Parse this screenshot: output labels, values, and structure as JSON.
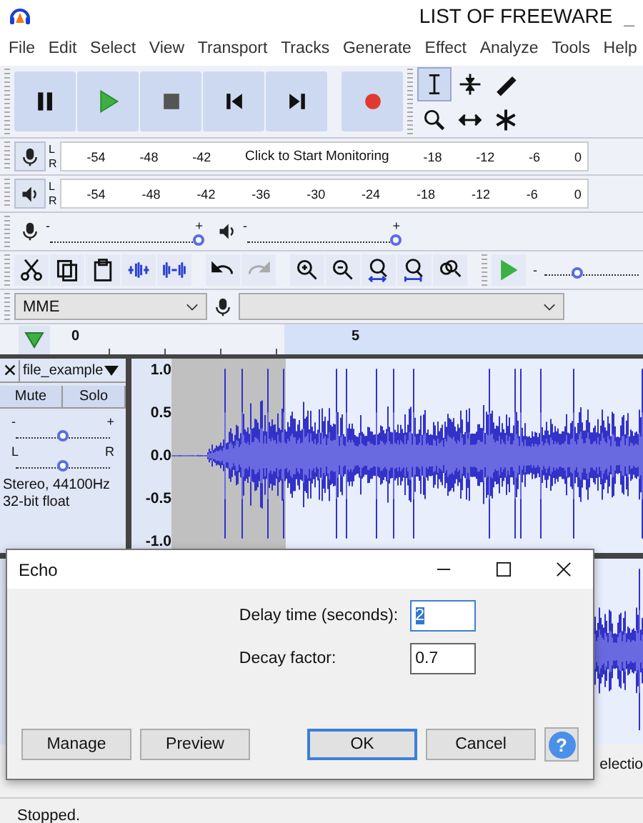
{
  "window": {
    "title": "LIST OF FREEWARE",
    "minimize_label": "_"
  },
  "menu": [
    "File",
    "Edit",
    "Select",
    "View",
    "Transport",
    "Tracks",
    "Generate",
    "Effect",
    "Analyze",
    "Tools",
    "Help"
  ],
  "transport": [
    {
      "kind": "pause"
    },
    {
      "kind": "play"
    },
    {
      "kind": "stop"
    },
    {
      "kind": "skip-start"
    },
    {
      "kind": "skip-end"
    },
    {
      "kind": "record"
    }
  ],
  "tools": [
    {
      "kind": "select",
      "selected": true
    },
    {
      "kind": "envelope",
      "selected": false
    },
    {
      "kind": "draw",
      "selected": false
    },
    {
      "kind": "zoom",
      "selected": false
    },
    {
      "kind": "time-shift",
      "selected": false
    },
    {
      "kind": "multi",
      "selected": false
    }
  ],
  "record_meter": {
    "left": "L",
    "right": "R",
    "scale": [
      "-54",
      "-48",
      "-42",
      "Click to Start Monitoring",
      "-18",
      "-12",
      "-6",
      "0"
    ]
  },
  "playback_meter": {
    "left": "L",
    "right": "R",
    "scale": [
      "-54",
      "-48",
      "-42",
      "-36",
      "-30",
      "-24",
      "-18",
      "-12",
      "-6",
      "0"
    ]
  },
  "mixer": {
    "recording": {
      "min": "-",
      "max": "+",
      "level": 1
    },
    "playback": {
      "min": "-",
      "max": "+",
      "level": 1
    }
  },
  "edit_toolbar": [
    {
      "kind": "cut",
      "disabled": false
    },
    {
      "kind": "copy",
      "disabled": false
    },
    {
      "kind": "paste",
      "disabled": false
    },
    {
      "kind": "trim",
      "disabled": false
    },
    {
      "kind": "silence",
      "disabled": false
    },
    {
      "kind": "undo",
      "disabled": false
    },
    {
      "kind": "redo",
      "disabled": true
    },
    {
      "kind": "zoom-in",
      "disabled": false
    },
    {
      "kind": "zoom-out",
      "disabled": false
    },
    {
      "kind": "fit-selection",
      "disabled": false
    },
    {
      "kind": "fit-project",
      "disabled": false
    },
    {
      "kind": "zoom-toggle",
      "disabled": false
    }
  ],
  "play_at_speed": {
    "min": "-",
    "level": 0.35
  },
  "device_toolbar": {
    "host": "MME"
  },
  "timeline": {
    "labels": [
      "0",
      "5"
    ]
  },
  "track": {
    "name": "file_example",
    "mute": "Mute",
    "solo": "Solo",
    "gain": {
      "min": "-",
      "max": "+",
      "level": 0.5
    },
    "pan": {
      "left": "L",
      "right": "R",
      "level": 0.5
    },
    "info": [
      "Stereo, 44100Hz",
      "32-bit float"
    ],
    "scale": [
      "1.0",
      "0.5",
      "0.0",
      "-0.5",
      "-1.0"
    ]
  },
  "selection_toolbar": {
    "label": "electio"
  },
  "dialog": {
    "title": "Echo",
    "fields": [
      {
        "label": "Delay time (seconds):",
        "value": "2",
        "focused": true
      },
      {
        "label": "Decay factor:",
        "value": "0.7",
        "focused": false
      }
    ],
    "left_buttons": [
      {
        "label": "Manage",
        "default": false
      },
      {
        "label": "Preview",
        "default": false
      }
    ],
    "right_buttons": [
      {
        "label": "OK",
        "default": true
      },
      {
        "label": "Cancel",
        "default": false
      }
    ],
    "help": "?"
  },
  "status": "Stopped."
}
